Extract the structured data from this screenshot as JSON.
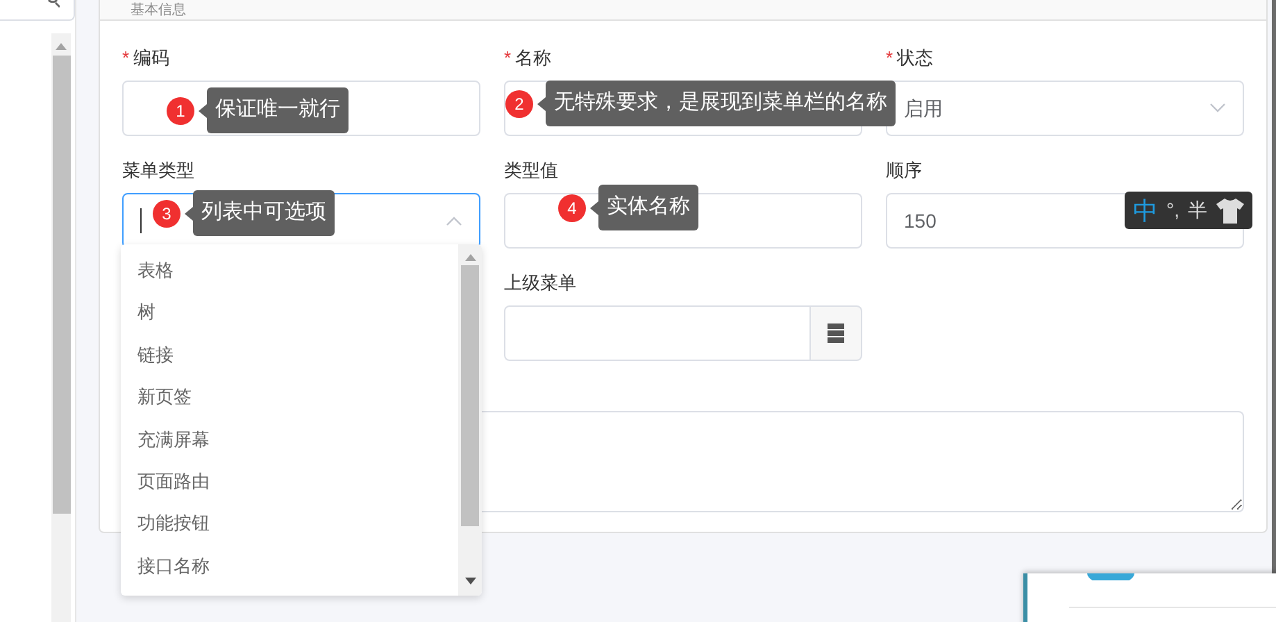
{
  "section": {
    "title": "基本信息"
  },
  "fields": [
    {
      "kind": "text",
      "label": "编码",
      "required_mark": "*"
    },
    {
      "kind": "text",
      "label": "名称",
      "required_mark": "*"
    },
    {
      "kind": "select",
      "label": "状态",
      "required_mark": "*",
      "value": "启用",
      "expanded": false
    },
    {
      "kind": "combo",
      "label": "菜单类型",
      "expanded": true
    },
    {
      "kind": "text",
      "label": "类型值"
    },
    {
      "kind": "text",
      "label": "顺序",
      "value": "150"
    },
    {
      "kind": "empty"
    },
    {
      "kind": "picker",
      "label": "上级菜单"
    }
  ],
  "dropdown": {
    "options": [
      "表格",
      "树",
      "链接",
      "新页签",
      "充满屏幕",
      "页面路由",
      "功能按钮",
      "接口名称"
    ]
  },
  "tooltips": [
    {
      "number": "1",
      "text": "保证唯一就行"
    },
    {
      "number": "2",
      "text": "无特殊要求，是展现到菜单栏的名称"
    },
    {
      "number": "3",
      "text": "列表中可选项"
    },
    {
      "number": "4",
      "text": "实体名称"
    }
  ],
  "ime": {
    "mode": "中",
    "punct": "°,",
    "width": "半"
  }
}
